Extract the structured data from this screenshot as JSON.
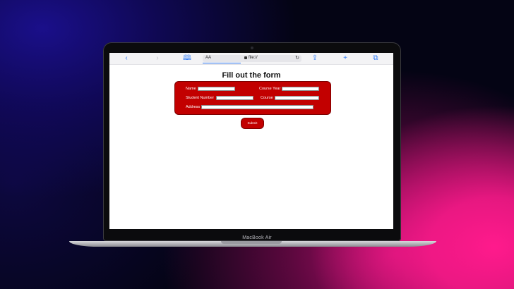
{
  "device": {
    "label": "MacBook Air"
  },
  "browser": {
    "address_prefix": "AA",
    "url": "file://",
    "icons": [
      "back-icon",
      "forward-icon",
      "bookmarks-icon",
      "lock-icon",
      "reload-icon",
      "share-icon",
      "new-tab-icon",
      "tabs-icon"
    ]
  },
  "page": {
    "title": "Fill out the form",
    "form": {
      "name_label": "Name",
      "course_year_label": "Course Year",
      "student_number_label": "Student Number",
      "course_label": "Course",
      "address_label": "Address",
      "name_value": "",
      "course_year_value": "",
      "student_number_value": "",
      "course_value": "",
      "address_value": ""
    },
    "submit_label": "Submit"
  },
  "colors": {
    "form_bg": "#c20000",
    "accent": "#2f7bf5"
  }
}
